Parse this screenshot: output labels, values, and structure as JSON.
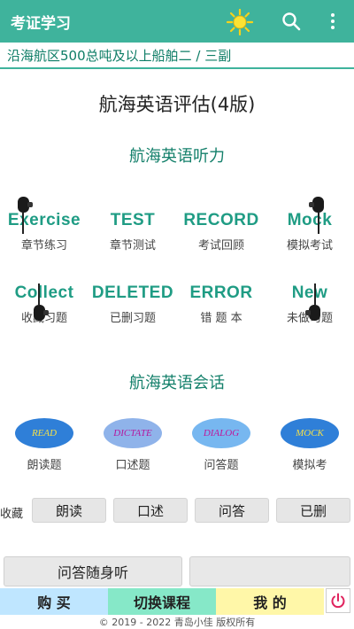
{
  "appbar": {
    "title": "考证学习",
    "accent": "#3fb39c"
  },
  "subtitle": "沿海航区500总吨及以上船舶二 / 三副",
  "main_title": "航海英语评估(4版)",
  "listening": {
    "title": "航海英语听力",
    "items": [
      {
        "en": "Exercise",
        "zh": "章节练习"
      },
      {
        "en": "TEST",
        "zh": "章节测试"
      },
      {
        "en": "RECORD",
        "zh": "考试回顾"
      },
      {
        "en": "Mock",
        "zh": "模拟考试"
      },
      {
        "en": "Collect",
        "zh": "收藏习题"
      },
      {
        "en": "DELETED",
        "zh": "已删习题"
      },
      {
        "en": "ERROR",
        "zh": "错 题 本"
      },
      {
        "en": "New",
        "zh": "未做习题"
      }
    ]
  },
  "conversation": {
    "title": "航海英语会话",
    "items": [
      {
        "badge": "READ",
        "zh": "朗读题",
        "color": "#2f7fd8",
        "text_color": "#f4e04a"
      },
      {
        "badge": "DICTATE",
        "zh": "口述题",
        "color": "#8fb3ea",
        "text_color": "#b5179e"
      },
      {
        "badge": "DIALOG",
        "zh": "问答题",
        "color": "#77b7f0",
        "text_color": "#c0179a"
      },
      {
        "badge": "MOCK",
        "zh": "模拟考",
        "color": "#2f7fd8",
        "text_color": "#f4e04a"
      }
    ]
  },
  "favorites": {
    "label": "收藏",
    "buttons": [
      "朗读",
      "口述",
      "问答",
      "已删"
    ]
  },
  "actions": {
    "qa_listen": "问答随身听"
  },
  "tabs": [
    {
      "label": "购 买",
      "color": "#bfe6ff"
    },
    {
      "label": "切换课程",
      "color": "#86e8c8"
    },
    {
      "label": "我 的",
      "color": "#fff7a8"
    }
  ],
  "copyright": "© 2019 - 2022 青岛小佳 版权所有",
  "icons": {
    "sun": "sun-icon",
    "search": "search-icon",
    "menu": "more-vert-icon",
    "power": "power-icon",
    "earphone": "earphone-icon"
  }
}
